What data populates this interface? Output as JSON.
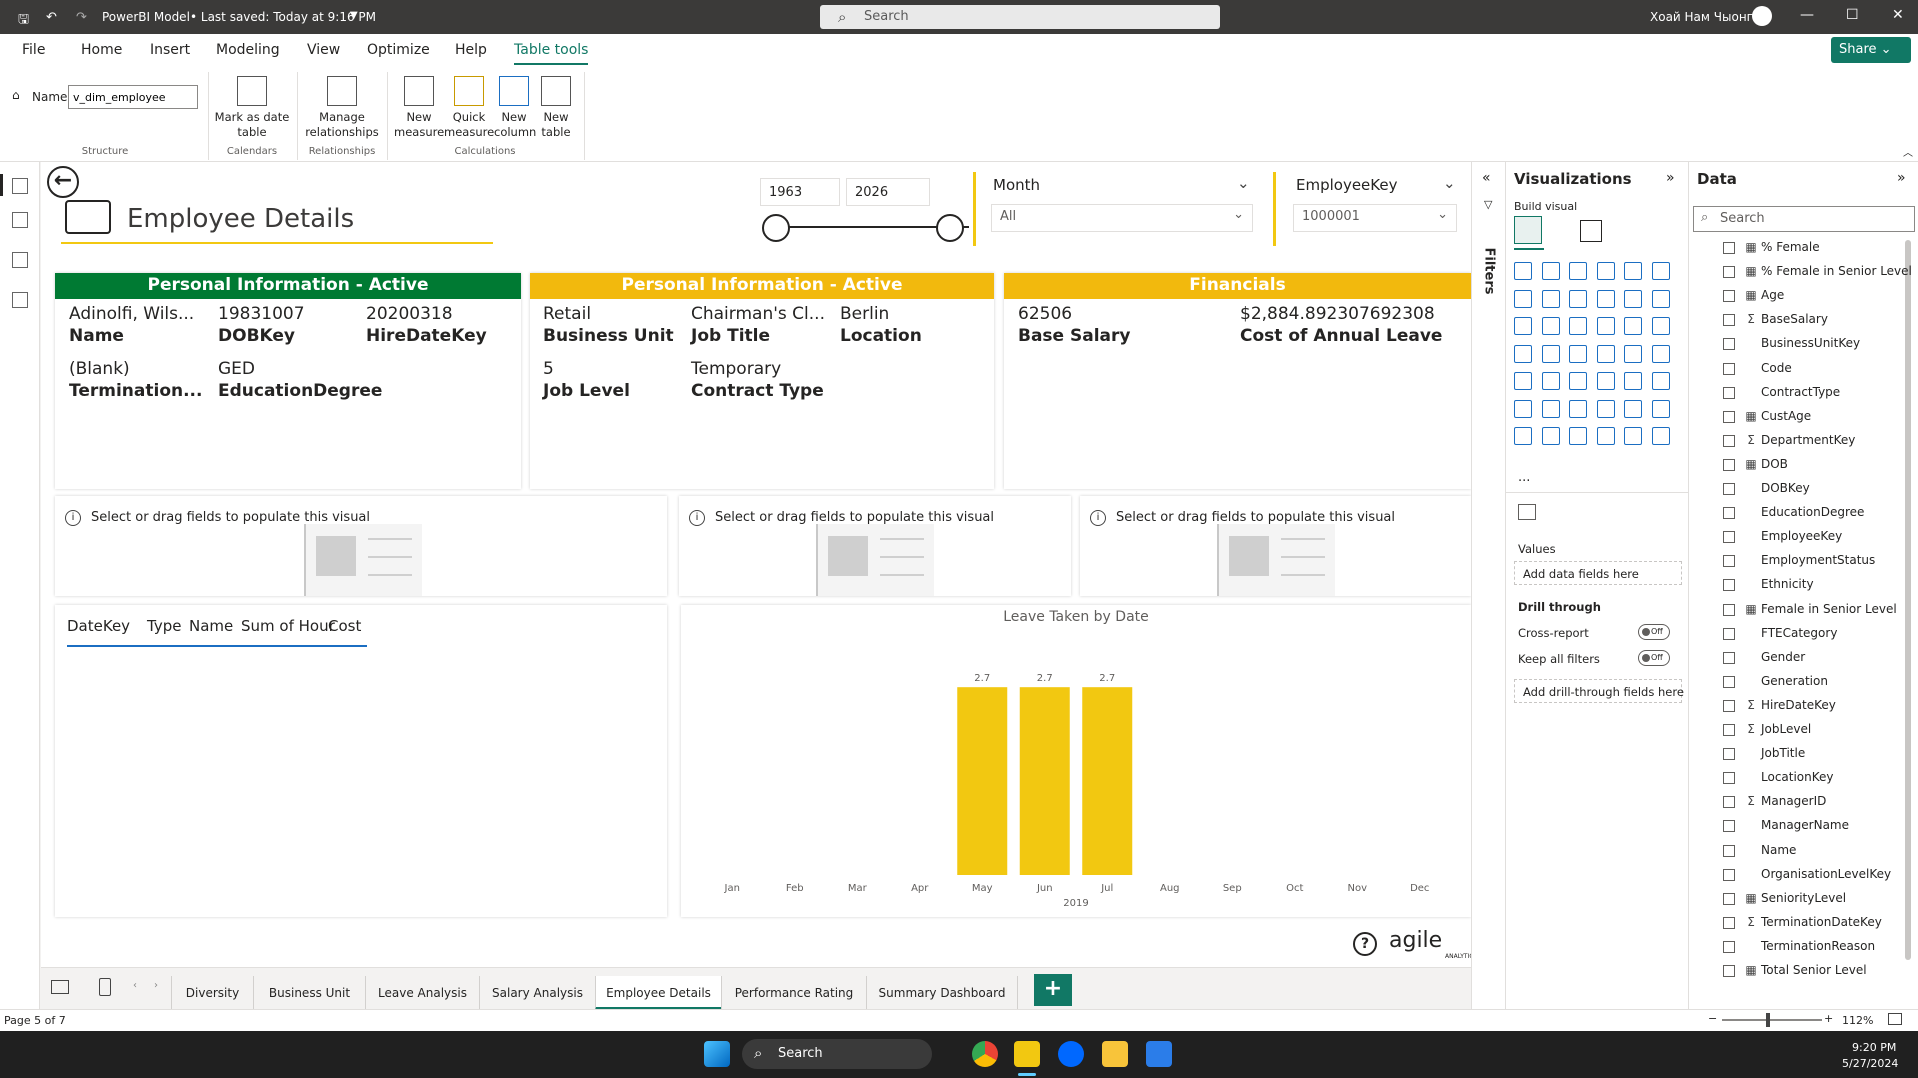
{
  "titlebar": {
    "save_label": "PowerBI Model",
    "status": "• Last saved: Today at 9:16 PM",
    "search_placeholder": "Search",
    "user": "Хоай Нам Чыонг"
  },
  "menu": [
    "File",
    "Home",
    "Insert",
    "Modeling",
    "View",
    "Optimize",
    "Help",
    "Table tools"
  ],
  "share_label": "Share",
  "ribbon": {
    "name_label": "Name",
    "name_value": "v_dim_employee",
    "buttons": [
      {
        "label1": "Mark as date",
        "label2": "table"
      },
      {
        "label1": "Manage",
        "label2": "relationships"
      },
      {
        "label1": "New",
        "label2": "measure"
      },
      {
        "label1": "Quick",
        "label2": "measure"
      },
      {
        "label1": "New",
        "label2": "column"
      },
      {
        "label1": "New",
        "label2": "table"
      }
    ],
    "groups": [
      "Structure",
      "Calendars",
      "Relationships",
      "Calculations"
    ]
  },
  "report": {
    "title": "Employee Details",
    "year_from": "1963",
    "year_to": "2026",
    "month_slicer": {
      "label": "Month",
      "value": "All"
    },
    "employee_slicer": {
      "label": "EmployeeKey",
      "value": "1000001"
    },
    "card1": {
      "header": "Personal Information - Active",
      "color": "#007a33",
      "fields": [
        {
          "value": "Adinolfi, Wils...",
          "label": "Name"
        },
        {
          "value": "19831007",
          "label": "DOBKey"
        },
        {
          "value": "20200318",
          "label": "HireDateKey"
        },
        {
          "value": "(Blank)",
          "label": "Termination..."
        },
        {
          "value": "GED",
          "label": "EducationDegree"
        }
      ]
    },
    "card2": {
      "header": "Personal Information - Active",
      "color": "#f2b90d",
      "fields": [
        {
          "value": "Retail",
          "label": "Business Unit"
        },
        {
          "value": "Chairman's Cl...",
          "label": "Job Title"
        },
        {
          "value": "Berlin",
          "label": "Location"
        },
        {
          "value": "5",
          "label": "Job Level"
        },
        {
          "value": "Temporary",
          "label": "Contract Type"
        }
      ]
    },
    "card3": {
      "header": "Financials",
      "color": "#f2b90d",
      "fields": [
        {
          "value": "62506",
          "label": "Base Salary"
        },
        {
          "value": "$2,884.892307692308",
          "label": "Cost of Annual Leave"
        }
      ]
    },
    "placeholder_text": "Select or drag fields to populate this visual",
    "table_headers": [
      "DateKey",
      "Type",
      "Name",
      "Sum of Hour",
      "Cost"
    ],
    "logo_text": "agile",
    "logo_sub": "ANALYTICS"
  },
  "chart_data": {
    "type": "bar",
    "title": "Leave Taken by Date",
    "xlabel": "2019",
    "categories": [
      "Jan",
      "Feb",
      "Mar",
      "Apr",
      "May",
      "Jun",
      "Jul",
      "Aug",
      "Sep",
      "Oct",
      "Nov",
      "Dec"
    ],
    "values": [
      null,
      null,
      null,
      null,
      2.7,
      2.7,
      2.7,
      null,
      null,
      null,
      null,
      null
    ],
    "color": "#f2c811",
    "ylim": [
      0,
      3
    ]
  },
  "filters_label": "Filters",
  "viz_pane": {
    "title": "Visualizations",
    "build_visual": "Build visual",
    "values_label": "Values",
    "add_fields": "Add data fields here",
    "drill_through": "Drill through",
    "cross_report": "Cross-report",
    "keep_filters": "Keep all filters",
    "toggle_off": "Off",
    "add_drill": "Add drill-through fields here",
    "more": "..."
  },
  "data_pane": {
    "title": "Data",
    "search_placeholder": "Search",
    "fields": [
      {
        "icon": "▦",
        "name": "% Female"
      },
      {
        "icon": "▦",
        "name": "% Female in Senior Level"
      },
      {
        "icon": "▦",
        "name": "Age"
      },
      {
        "icon": "Σ",
        "name": "BaseSalary"
      },
      {
        "icon": "",
        "name": "BusinessUnitKey"
      },
      {
        "icon": "",
        "name": "Code"
      },
      {
        "icon": "",
        "name": "ContractType"
      },
      {
        "icon": "▦",
        "name": "CustAge"
      },
      {
        "icon": "Σ",
        "name": "DepartmentKey"
      },
      {
        "icon": "▦",
        "name": "DOB"
      },
      {
        "icon": "",
        "name": "DOBKey"
      },
      {
        "icon": "",
        "name": "EducationDegree"
      },
      {
        "icon": "",
        "name": "EmployeeKey"
      },
      {
        "icon": "",
        "name": "EmploymentStatus"
      },
      {
        "icon": "",
        "name": "Ethnicity"
      },
      {
        "icon": "▦",
        "name": "Female in Senior Level"
      },
      {
        "icon": "",
        "name": "FTECategory"
      },
      {
        "icon": "",
        "name": "Gender"
      },
      {
        "icon": "",
        "name": "Generation"
      },
      {
        "icon": "Σ",
        "name": "HireDateKey"
      },
      {
        "icon": "Σ",
        "name": "JobLevel"
      },
      {
        "icon": "",
        "name": "JobTitle"
      },
      {
        "icon": "",
        "name": "LocationKey"
      },
      {
        "icon": "Σ",
        "name": "ManagerID"
      },
      {
        "icon": "",
        "name": "ManagerName"
      },
      {
        "icon": "",
        "name": "Name"
      },
      {
        "icon": "",
        "name": "OrganisationLevelKey"
      },
      {
        "icon": "▦",
        "name": "SeniorityLevel"
      },
      {
        "icon": "Σ",
        "name": "TerminationDateKey"
      },
      {
        "icon": "",
        "name": "TerminationReason"
      },
      {
        "icon": "▦",
        "name": "Total Senior Level"
      }
    ]
  },
  "tabs": [
    "Diversity",
    "Business Unit",
    "Leave Analysis",
    "Salary Analysis",
    "Employee Details",
    "Performance Rating",
    "Summary Dashboard"
  ],
  "status": {
    "page": "Page 5 of 7",
    "zoom": "112%"
  },
  "taskbar": {
    "search": "Search",
    "time": "9:20 PM",
    "date": "5/27/2024"
  }
}
